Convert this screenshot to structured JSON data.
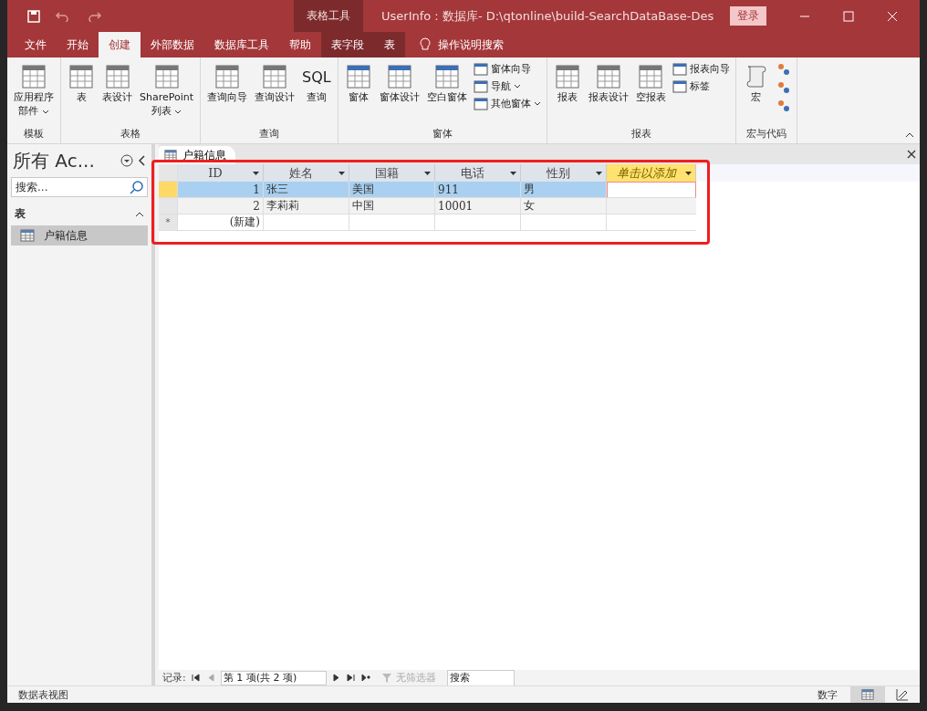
{
  "title_bar": {
    "context_label": "表格工具",
    "title": "UserInfo : 数据库- D:\\qtonline\\build-SearchDataBase-Des",
    "login": "登录"
  },
  "menu_tabs": [
    {
      "label": "文件",
      "selected": false,
      "kind": "normal"
    },
    {
      "label": "开始",
      "selected": false,
      "kind": "normal"
    },
    {
      "label": "创建",
      "selected": true,
      "kind": "normal"
    },
    {
      "label": "外部数据",
      "selected": false,
      "kind": "normal"
    },
    {
      "label": "数据库工具",
      "selected": false,
      "kind": "normal"
    },
    {
      "label": "帮助",
      "selected": false,
      "kind": "normal"
    },
    {
      "label": "表字段",
      "selected": false,
      "kind": "context"
    },
    {
      "label": "表",
      "selected": false,
      "kind": "context"
    }
  ],
  "tell_me": "操作说明搜索",
  "ribbon": [
    {
      "label": "模板",
      "items": [
        {
          "kind": "large",
          "lines": [
            "应用程序",
            "部件"
          ],
          "dropdown": true
        }
      ]
    },
    {
      "label": "表格",
      "items": [
        {
          "kind": "large",
          "lines": [
            "表"
          ]
        },
        {
          "kind": "large",
          "lines": [
            "表设计"
          ]
        },
        {
          "kind": "large",
          "lines": [
            "SharePoint",
            "列表"
          ],
          "dropdown": true
        }
      ]
    },
    {
      "label": "查询",
      "items": [
        {
          "kind": "large",
          "lines": [
            "查询向导"
          ]
        },
        {
          "kind": "large",
          "lines": [
            "查询设计"
          ]
        },
        {
          "kind": "glyph",
          "glyph": "SQL",
          "lines": [
            "查询"
          ]
        }
      ]
    },
    {
      "label": "窗体",
      "items": [
        {
          "kind": "large",
          "lines": [
            "窗体"
          ]
        },
        {
          "kind": "large",
          "lines": [
            "窗体设计"
          ]
        },
        {
          "kind": "large",
          "lines": [
            "空白窗体"
          ]
        },
        {
          "kind": "small",
          "lines": [
            "窗体向导"
          ]
        },
        {
          "kind": "small",
          "lines": [
            "导航"
          ],
          "dropdown": true
        },
        {
          "kind": "small",
          "lines": [
            "其他窗体"
          ],
          "dropdown": true
        }
      ]
    },
    {
      "label": "报表",
      "items": [
        {
          "kind": "large",
          "lines": [
            "报表"
          ]
        },
        {
          "kind": "large",
          "lines": [
            "报表设计"
          ]
        },
        {
          "kind": "large",
          "lines": [
            "空报表"
          ]
        },
        {
          "kind": "small",
          "lines": [
            "报表向导"
          ]
        },
        {
          "kind": "small",
          "lines": [
            "标签"
          ]
        }
      ]
    },
    {
      "label": "宏与代码",
      "items": [
        {
          "kind": "large",
          "lines": [
            "宏"
          ]
        },
        {
          "kind": "mini"
        },
        {
          "kind": "mini"
        },
        {
          "kind": "mini"
        }
      ]
    }
  ],
  "nav_pane": {
    "title": "所有 Ac...",
    "search": {
      "placeholder": "搜索..."
    },
    "section": {
      "label": "表",
      "expanded": true
    },
    "items": [
      {
        "label": "户籍信息",
        "selected": true
      }
    ]
  },
  "document_tab": {
    "label": "户籍信息"
  },
  "table": {
    "columns": [
      {
        "label": "ID",
        "kind": "field"
      },
      {
        "label": "姓名",
        "kind": "field"
      },
      {
        "label": "国籍",
        "kind": "field"
      },
      {
        "label": "电话",
        "kind": "field"
      },
      {
        "label": "性别",
        "kind": "field"
      },
      {
        "label": "单击以添加",
        "kind": "add"
      }
    ],
    "rows": [
      {
        "cells": [
          "1",
          "张三",
          "美国",
          "911",
          "男"
        ],
        "selected": true,
        "kind": "record"
      },
      {
        "cells": [
          "2",
          "李莉莉",
          "中国",
          "10001",
          "女"
        ],
        "selected": false,
        "kind": "record"
      },
      {
        "marker": "*",
        "cells": [
          "(新建)"
        ],
        "selected": false,
        "kind": "new"
      }
    ]
  },
  "record_nav": {
    "label": "记录:",
    "position": "第 1 项(共 2 项)",
    "filter": "无筛选器",
    "search": "搜索"
  },
  "status_bar": {
    "view": "数据表视图",
    "mode": "数字"
  }
}
